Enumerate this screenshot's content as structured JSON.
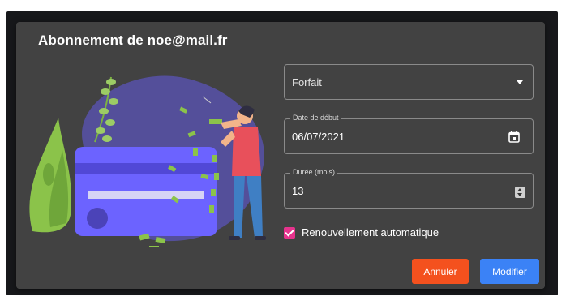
{
  "dialog": {
    "title": "Abonnement de noe@mail.fr"
  },
  "form": {
    "plan": {
      "placeholder": "Forfait",
      "icon": "chevron-down-icon"
    },
    "start_date": {
      "label": "Date de début",
      "value": "06/07/2021",
      "icon": "calendar-icon"
    },
    "duration": {
      "label": "Durée (mois)",
      "value": "13",
      "icon": "spinner-icon"
    },
    "auto_renew": {
      "label": "Renouvellement automatique",
      "checked": true
    }
  },
  "actions": {
    "cancel_label": "Annuler",
    "submit_label": "Modifier"
  },
  "colors": {
    "dialog_bg": "#424242",
    "checkbox_accent": "#e6338d",
    "cancel_bg": "#f4511e",
    "submit_bg": "#3b82f6"
  }
}
